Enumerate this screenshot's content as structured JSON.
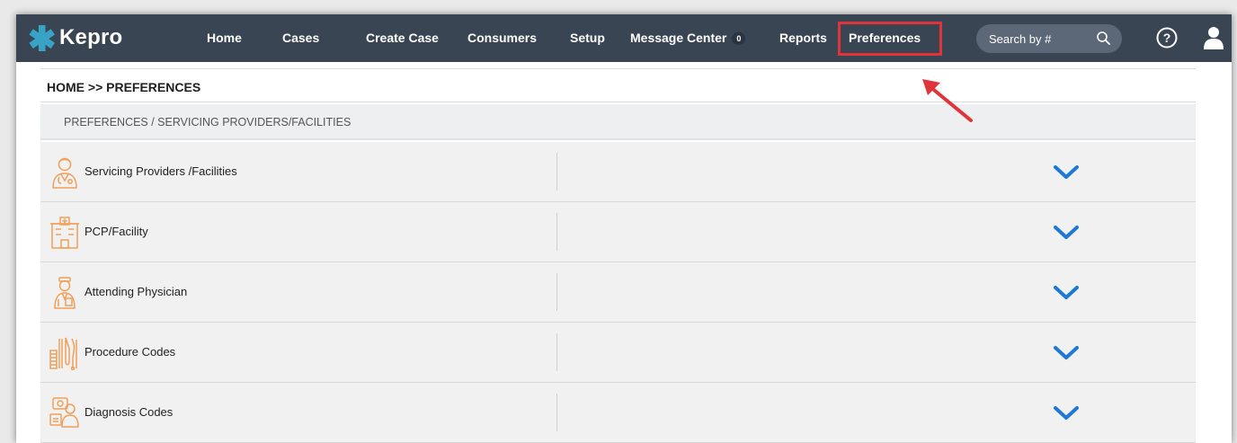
{
  "app": {
    "logo_text": "Kepro",
    "brand_accent": "#39a3c6"
  },
  "nav": {
    "items": [
      {
        "label": "Home"
      },
      {
        "label": "Cases"
      },
      {
        "label": "Create Case"
      },
      {
        "label": "Consumers"
      },
      {
        "label": "Setup"
      },
      {
        "label": "Message Center",
        "badge": "0"
      },
      {
        "label": "Reports"
      },
      {
        "label": "Preferences",
        "highlighted": true
      }
    ],
    "search_placeholder": "Search by #",
    "highlight_color": "#e0333a"
  },
  "page": {
    "breadcrumb": "HOME >> PREFERENCES",
    "section_header": "PREFERENCES / SERVICING PROVIDERS/FACILITIES"
  },
  "sections": [
    {
      "label": "Servicing Providers /Facilities",
      "icon": "doctor-icon"
    },
    {
      "label": "PCP/Facility",
      "icon": "hospital-icon"
    },
    {
      "label": "Attending Physician",
      "icon": "physician-icon"
    },
    {
      "label": "Procedure Codes",
      "icon": "instruments-icon"
    },
    {
      "label": "Diagnosis Codes",
      "icon": "diagnosis-icon"
    }
  ],
  "colors": {
    "topbar": "#3a4554",
    "chevron": "#1e78d6",
    "icon_orange": "#f0a05a"
  }
}
